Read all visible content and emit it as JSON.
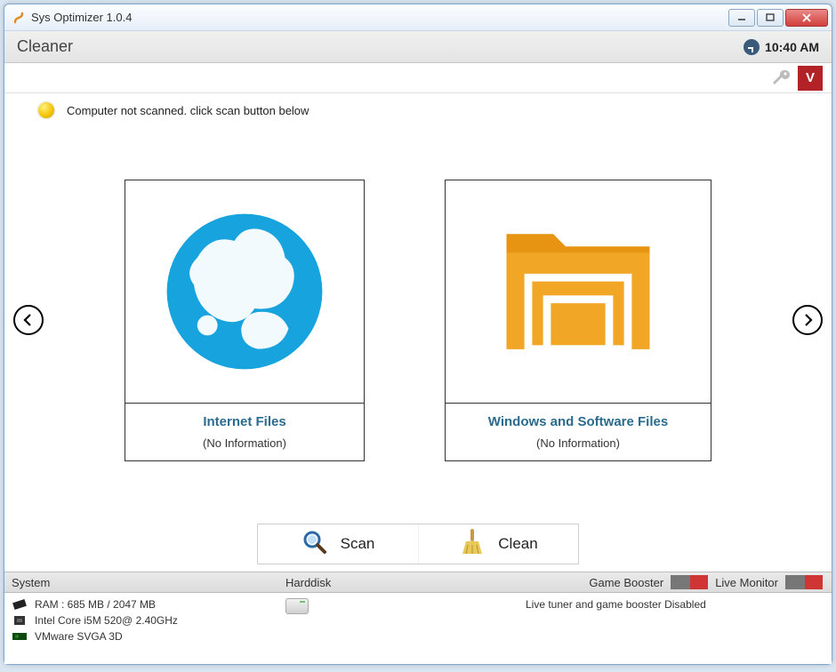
{
  "window": {
    "title": "Sys Optimizer 1.0.4"
  },
  "header": {
    "page_title": "Cleaner",
    "time": "10:40 AM"
  },
  "toolbar": {
    "v_label": "V"
  },
  "status": {
    "message": "Computer not scanned. click scan button below"
  },
  "cards": {
    "internet": {
      "title": "Internet Files",
      "sub": "(No Information)"
    },
    "windows": {
      "title": "Windows and Software Files",
      "sub": "(No Information)"
    }
  },
  "actions": {
    "scan": "Scan",
    "clean": "Clean"
  },
  "footer": {
    "system_label": "System",
    "harddisk_label": "Harddisk",
    "game_booster_label": "Game Booster",
    "live_monitor_label": "Live Monitor",
    "ram": "RAM : 685 MB / 2047 MB",
    "cpu": "Intel Core i5M 520@ 2.40GHz",
    "gpu": "VMware SVGA 3D",
    "tuner_status": "Live tuner and game booster Disabled"
  }
}
